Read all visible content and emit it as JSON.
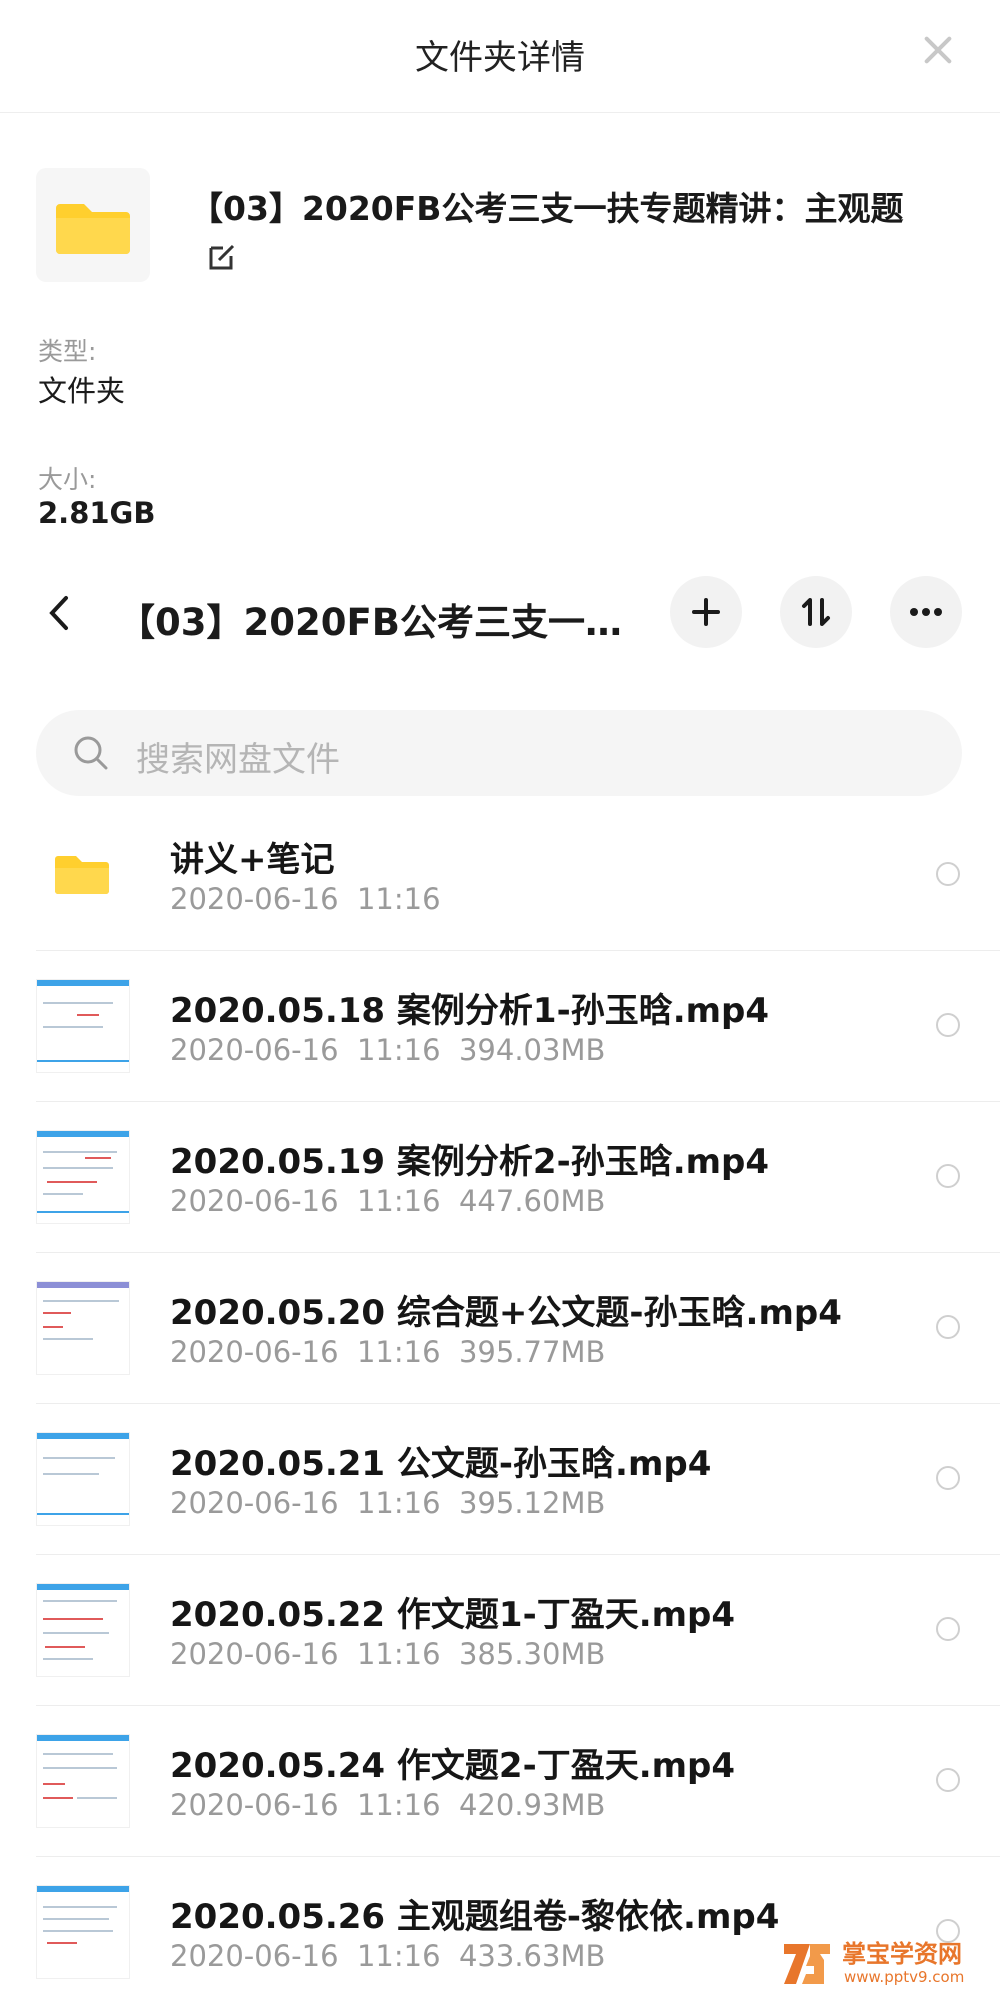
{
  "header": {
    "title": "文件夹详情"
  },
  "folder": {
    "name": "【03】2020FB公考三支一扶专题精讲：主观题",
    "type_label": "类型:",
    "type_value": "文件夹",
    "size_label": "大小:",
    "size_value": "2.81GB"
  },
  "path_bar": {
    "title": "【03】2020FB公考三支一…"
  },
  "search": {
    "placeholder": "搜索网盘文件"
  },
  "files": [
    {
      "name": "讲义+笔记",
      "meta": "2020-06-16  11:16",
      "kind": "folder"
    },
    {
      "name": "2020.05.18 案例分析1-孙玉晗.mp4",
      "meta": "2020-06-16  11:16  394.03MB",
      "kind": "video"
    },
    {
      "name": "2020.05.19 案例分析2-孙玉晗.mp4",
      "meta": "2020-06-16  11:16  447.60MB",
      "kind": "video"
    },
    {
      "name": "2020.05.20 综合题+公文题-孙玉晗.mp4",
      "meta": "2020-06-16  11:16  395.77MB",
      "kind": "video"
    },
    {
      "name": "2020.05.21 公文题-孙玉晗.mp4",
      "meta": "2020-06-16  11:16  395.12MB",
      "kind": "video"
    },
    {
      "name": "2020.05.22 作文题1-丁盈天.mp4",
      "meta": "2020-06-16  11:16  385.30MB",
      "kind": "video"
    },
    {
      "name": "2020.05.24 作文题2-丁盈天.mp4",
      "meta": "2020-06-16  11:16  420.93MB",
      "kind": "video"
    },
    {
      "name": "2020.05.26 主观题组卷-黎依依.mp4",
      "meta": "2020-06-16  11:16  433.63MB",
      "kind": "video"
    }
  ],
  "watermark": {
    "title": "掌宝学资网",
    "url": "www.pptv9.com"
  },
  "colors": {
    "folder_yellow": "#ffcf2e",
    "video_accent": "#3da3e8"
  }
}
